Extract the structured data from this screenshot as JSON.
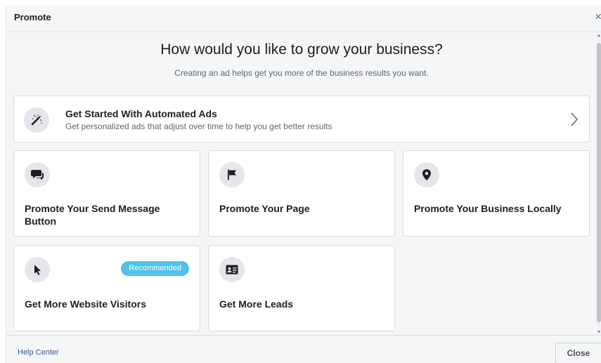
{
  "header": {
    "title": "Promote",
    "close_glyph": "×"
  },
  "main": {
    "headline": "How would you like to grow your business?",
    "subhead": "Creating an ad helps get you more of the business results you want.",
    "automated": {
      "title": "Get Started With Automated Ads",
      "description": "Get personalized ads that adjust over time to help you get better results",
      "icon": "magic-wand-icon"
    },
    "options": [
      {
        "title": "Promote Your Send Message Button",
        "icon": "speech-bubbles-icon"
      },
      {
        "title": "Promote Your Page",
        "icon": "flag-icon"
      },
      {
        "title": "Promote Your Business Locally",
        "icon": "location-pin-icon"
      },
      {
        "title": "Get More Website Visitors",
        "icon": "cursor-arrow-icon",
        "badge": "Recommended"
      },
      {
        "title": "Get More Leads",
        "icon": "contact-card-icon"
      }
    ]
  },
  "footer": {
    "help_link": "Help Center",
    "close_label": "Close"
  },
  "colors": {
    "badge": "#4fc3e8",
    "link": "#385898",
    "icon_bg": "#e4e6eb",
    "panel_bg": "#f5f6f7"
  }
}
